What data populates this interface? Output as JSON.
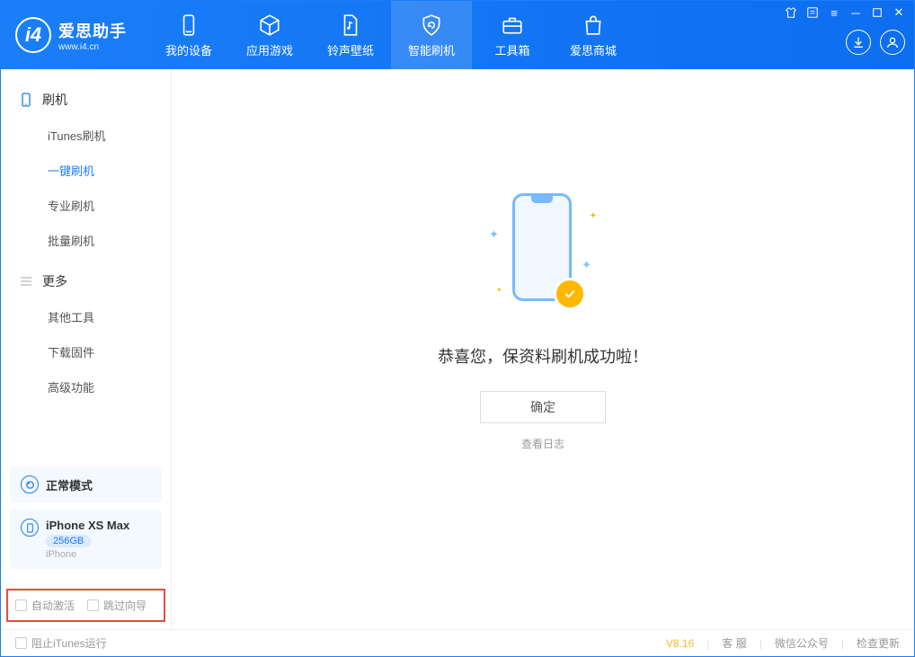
{
  "app": {
    "title": "爱思助手",
    "subtitle": "www.i4.cn"
  },
  "nav": {
    "items": [
      {
        "label": "我的设备"
      },
      {
        "label": "应用游戏"
      },
      {
        "label": "铃声壁纸"
      },
      {
        "label": "智能刷机"
      },
      {
        "label": "工具箱"
      },
      {
        "label": "爱思商城"
      }
    ]
  },
  "sidebar": {
    "sections": [
      {
        "title": "刷机",
        "items": [
          {
            "label": "iTunes刷机"
          },
          {
            "label": "一键刷机"
          },
          {
            "label": "专业刷机"
          },
          {
            "label": "批量刷机"
          }
        ]
      },
      {
        "title": "更多",
        "items": [
          {
            "label": "其他工具"
          },
          {
            "label": "下载固件"
          },
          {
            "label": "高级功能"
          }
        ]
      }
    ],
    "mode_card": {
      "label": "正常模式"
    },
    "device_card": {
      "name": "iPhone XS Max",
      "badge": "256GB",
      "sub": "iPhone"
    },
    "checkboxes": {
      "auto_activate": "自动激活",
      "skip_guide": "跳过向导"
    }
  },
  "main": {
    "success_message": "恭喜您，保资料刷机成功啦！",
    "ok_button": "确定",
    "view_log": "查看日志"
  },
  "footer": {
    "block_itunes": "阻止iTunes运行",
    "version": "V8.16",
    "links": {
      "support": "客 服",
      "wechat": "微信公众号",
      "update": "检查更新"
    }
  }
}
